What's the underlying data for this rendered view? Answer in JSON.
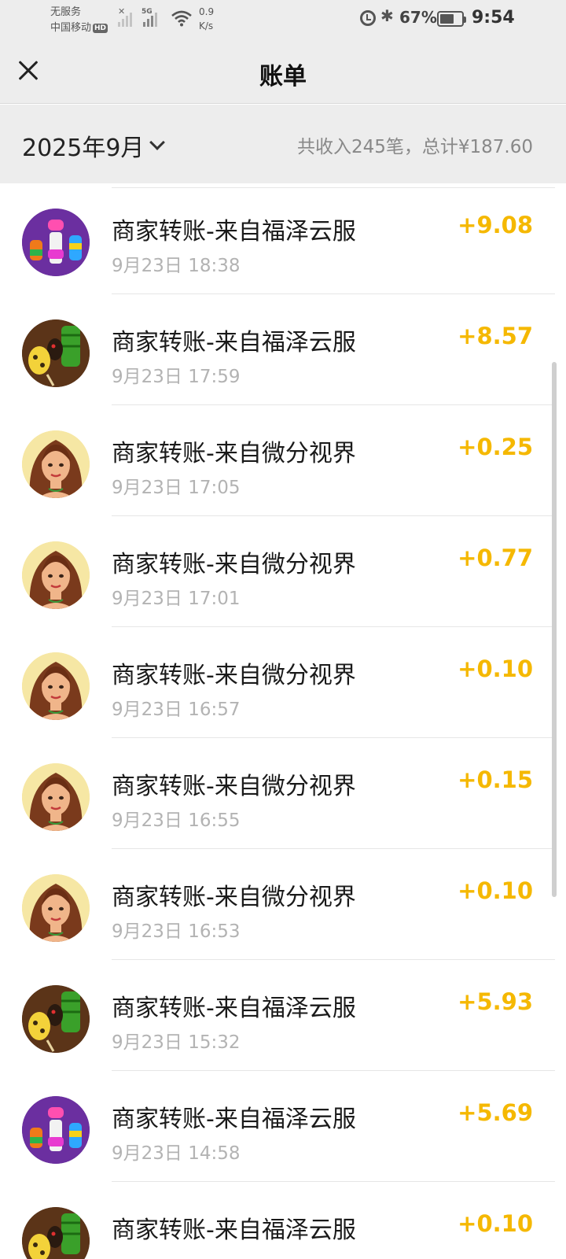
{
  "status_bar": {
    "carrier_line1": "无服务",
    "carrier_line2": "中国移动",
    "hd_badge": "HD",
    "network_5g": "5G",
    "speed_value": "0.9",
    "speed_unit": "K/s",
    "battery": "67%",
    "battery_level": 0.67,
    "time": "9:54",
    "icons": [
      "signal-icon",
      "wifi-icon",
      "alarm-icon",
      "bluetooth-icon",
      "battery-icon"
    ]
  },
  "nav": {
    "title": "账单",
    "close_icon": "close-icon"
  },
  "filter": {
    "month": "2025年9月",
    "summary": "共收入245笔，总计¥187.60"
  },
  "colors": {
    "amount": "#f5b800",
    "header_bg": "#ededed"
  },
  "transactions": [
    {
      "title": "商家转账-来自福泽云服",
      "time": "9月23日 18:38",
      "amount": "+9.08",
      "avatar": "rings-game-icon"
    },
    {
      "title": "商家转账-来自福泽云服",
      "time": "9月23日 17:59",
      "amount": "+8.57",
      "avatar": "skewers-game-icon"
    },
    {
      "title": "商家转账-来自微分视界",
      "time": "9月23日 17:05",
      "amount": "+0.25",
      "avatar": "woman-portrait-icon"
    },
    {
      "title": "商家转账-来自微分视界",
      "time": "9月23日 17:01",
      "amount": "+0.77",
      "avatar": "woman-portrait-icon"
    },
    {
      "title": "商家转账-来自微分视界",
      "time": "9月23日 16:57",
      "amount": "+0.10",
      "avatar": "woman-portrait-icon"
    },
    {
      "title": "商家转账-来自微分视界",
      "time": "9月23日 16:55",
      "amount": "+0.15",
      "avatar": "woman-portrait-icon"
    },
    {
      "title": "商家转账-来自微分视界",
      "time": "9月23日 16:53",
      "amount": "+0.10",
      "avatar": "woman-portrait-icon"
    },
    {
      "title": "商家转账-来自福泽云服",
      "time": "9月23日 15:32",
      "amount": "+5.93",
      "avatar": "skewers-game-icon"
    },
    {
      "title": "商家转账-来自福泽云服",
      "time": "9月23日 14:58",
      "amount": "+5.69",
      "avatar": "rings-game-icon"
    },
    {
      "title": "商家转账-来自福泽云服",
      "time": "",
      "amount": "+0.10",
      "avatar": "skewers-game-icon"
    }
  ]
}
